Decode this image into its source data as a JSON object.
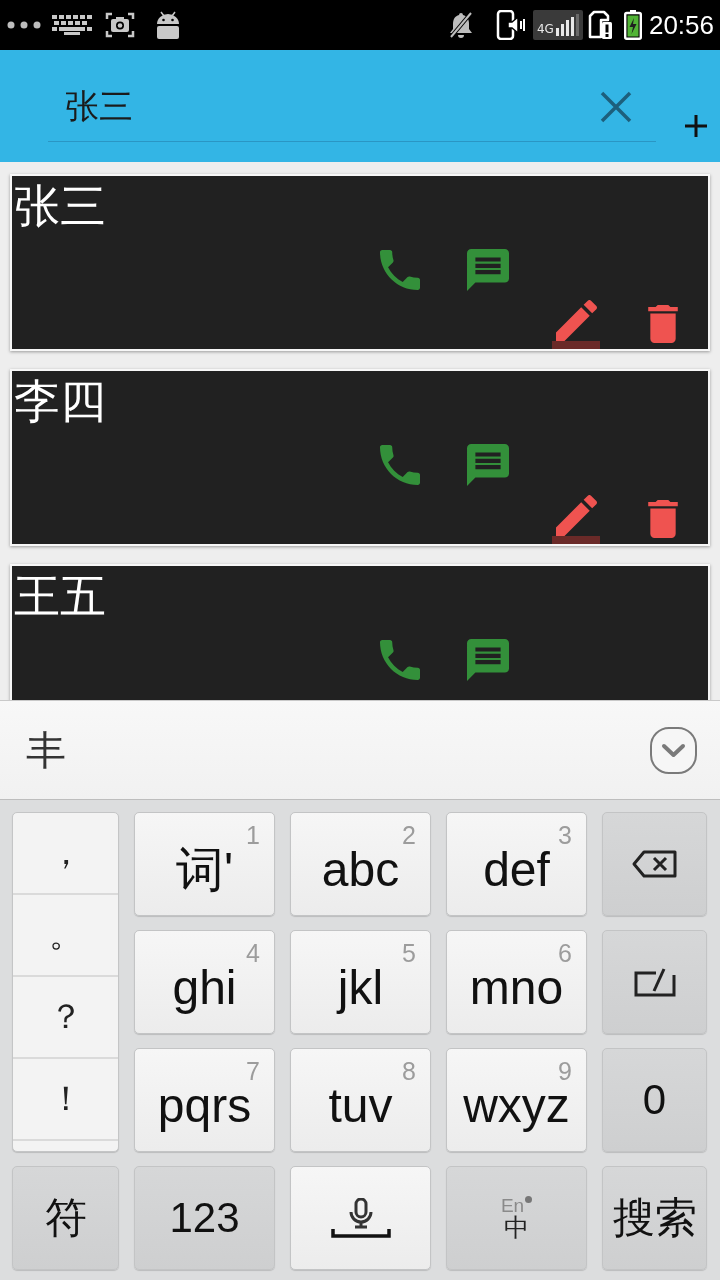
{
  "status_bar": {
    "network_type": "4G",
    "time": "20:56"
  },
  "search": {
    "value": "张三"
  },
  "contacts": [
    {
      "name": "张三"
    },
    {
      "name": "李四"
    },
    {
      "name": "王五"
    }
  ],
  "keyboard": {
    "candidates": [
      {
        "text": "丰"
      }
    ],
    "punctuation": [
      "，",
      "。",
      "？",
      "！"
    ],
    "keys": [
      {
        "kind": "letter",
        "label": "词'",
        "digit": "1"
      },
      {
        "kind": "letter",
        "label": "abc",
        "digit": "2"
      },
      {
        "kind": "letter",
        "label": "def",
        "digit": "3"
      },
      {
        "kind": "backspace"
      },
      {
        "kind": "letter",
        "label": "ghi",
        "digit": "4"
      },
      {
        "kind": "letter",
        "label": "jkl",
        "digit": "5"
      },
      {
        "kind": "letter",
        "label": "mno",
        "digit": "6"
      },
      {
        "kind": "reinput"
      },
      {
        "kind": "letter",
        "label": "pqrs",
        "digit": "7"
      },
      {
        "kind": "letter",
        "label": "tuv",
        "digit": "8"
      },
      {
        "kind": "letter",
        "label": "wxyz",
        "digit": "9"
      },
      {
        "kind": "function",
        "label": "0"
      },
      {
        "kind": "function",
        "label": "符"
      },
      {
        "kind": "function",
        "label": "123"
      },
      {
        "kind": "space"
      },
      {
        "kind": "language",
        "label": "中",
        "hint": "En"
      },
      {
        "kind": "function",
        "label": "搜索"
      }
    ]
  }
}
